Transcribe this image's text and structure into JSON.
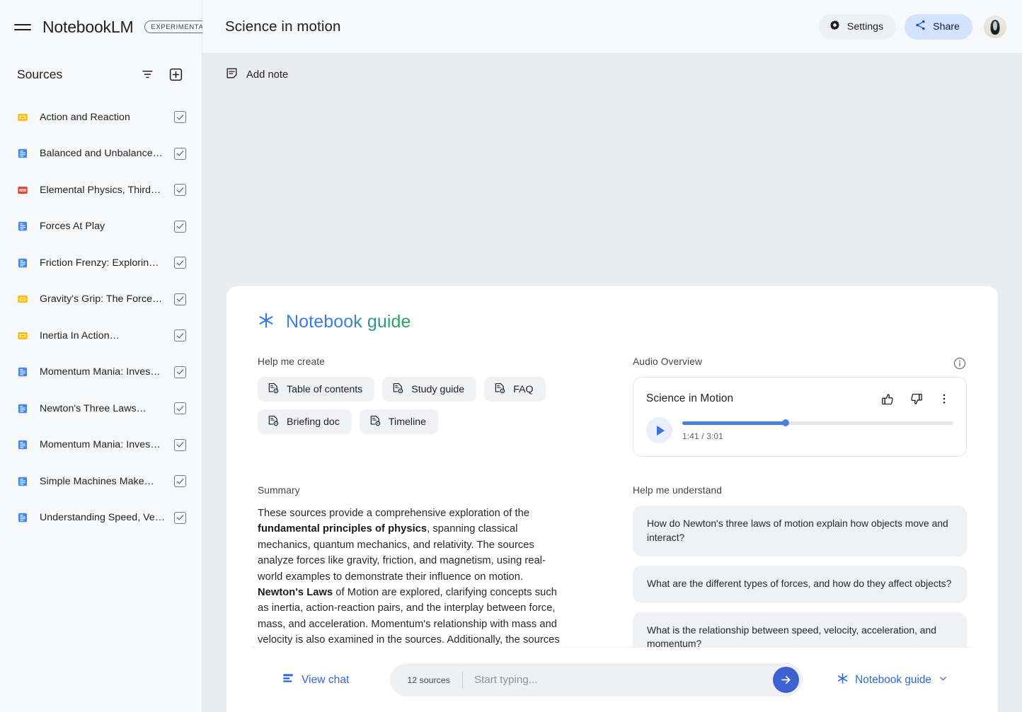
{
  "app": {
    "brand": "NotebookLM",
    "badge": "EXPERIMENTAL"
  },
  "sidebar": {
    "sources_title": "Sources",
    "filter_icon": "filter-icon",
    "add_icon": "add-source-icon",
    "items": [
      {
        "label": "Action and Reaction",
        "type": "slides",
        "checked": true
      },
      {
        "label": "Balanced and Unbalance…",
        "type": "doc",
        "checked": true
      },
      {
        "label": "Elemental Physics, Third…",
        "type": "pdf",
        "checked": true
      },
      {
        "label": "Forces At Play",
        "type": "doc",
        "checked": true
      },
      {
        "label": "Friction Frenzy: Explorin…",
        "type": "doc",
        "checked": true
      },
      {
        "label": "Gravity's Grip: The Force…",
        "type": "slides",
        "checked": true
      },
      {
        "label": "Inertia In Action…",
        "type": "slides",
        "checked": true
      },
      {
        "label": "Momentum Mania: Inves…",
        "type": "doc",
        "checked": true
      },
      {
        "label": "Newton's Three Laws…",
        "type": "doc",
        "checked": true
      },
      {
        "label": "Momentum Mania: Inves…",
        "type": "doc",
        "checked": true
      },
      {
        "label": "Simple Machines Make…",
        "type": "doc",
        "checked": true
      },
      {
        "label": "Understanding Speed, Ve…",
        "type": "doc",
        "checked": true
      }
    ]
  },
  "header": {
    "notebook_title": "Science in motion",
    "settings_label": "Settings",
    "share_label": "Share",
    "settings_icon": "gear-icon",
    "share_icon": "share-icon",
    "avatar": "user-avatar-penguin"
  },
  "toolbar": {
    "add_note_label": "Add note",
    "add_note_icon": "note-add-icon"
  },
  "guide": {
    "title": "Notebook guide",
    "title_icon": "sparkle-icon",
    "help_me_create_label": "Help me create",
    "create_chips": [
      {
        "label": "Table of contents",
        "icon": "doc-gear-icon"
      },
      {
        "label": "Study guide",
        "icon": "doc-gear-icon"
      },
      {
        "label": "FAQ",
        "icon": "doc-gear-icon"
      },
      {
        "label": "Briefing doc",
        "icon": "doc-gear-icon"
      },
      {
        "label": "Timeline",
        "icon": "doc-gear-icon"
      }
    ],
    "summary_label": "Summary",
    "summary_html": "These sources provide a comprehensive exploration of the <b>fundamental principles of physics</b>, spanning classical mechanics, quantum mechanics, and relativity. The sources analyze forces like gravity, friction, and magnetism, using real-world examples to demonstrate their influence on motion. <b>Newton's Laws</b> of Motion are explored, clarifying concepts such as inertia, action-reaction pairs, and the interplay between force, mass, and acceleration. Momentum's relationship with mass and velocity is also examined in the sources. Additionally, the sources illustrate how <b>simple machines</b>, like levers and ramps, facilitate work."
  },
  "audio_overview": {
    "label": "Audio Overview",
    "info_icon": "info-icon",
    "track_title": "Science in Motion",
    "thumbs_up_icon": "thumb-up-icon",
    "thumbs_down_icon": "thumb-down-icon",
    "more_icon": "more-vertical-icon",
    "play_icon": "play-icon",
    "current_time": "1:41",
    "total_time": "3:01",
    "time_display": "1:41 / 3:01",
    "progress_percent": 38
  },
  "help_me_understand": {
    "label": "Help me understand",
    "suggestions": [
      "How do Newton's three laws of motion explain how objects move and interact?",
      "What are the different types of forces, and how do they affect objects?",
      "What is the relationship between speed, velocity, acceleration, and momentum?"
    ]
  },
  "bottom_bar": {
    "view_chat_label": "View chat",
    "view_chat_icon": "chat-list-icon",
    "sources_count_label": "12 sources",
    "input_placeholder": "Start typing...",
    "input_value": "",
    "send_icon": "arrow-right-icon",
    "notebook_guide_label": "Notebook guide",
    "notebook_guide_icon": "sparkle-icon",
    "chevron_icon": "chevron-down-icon"
  },
  "colors": {
    "accent_blue": "#3166d8",
    "send_blue": "#3b62d0",
    "share_chip": "#d3e3fd",
    "progress_blue": "#4a7fe0",
    "slides_yellow": "#fbbc04",
    "doc_blue": "#4285f4",
    "pdf_red": "#ea4335",
    "canvas_bg": "#eaecf0"
  }
}
